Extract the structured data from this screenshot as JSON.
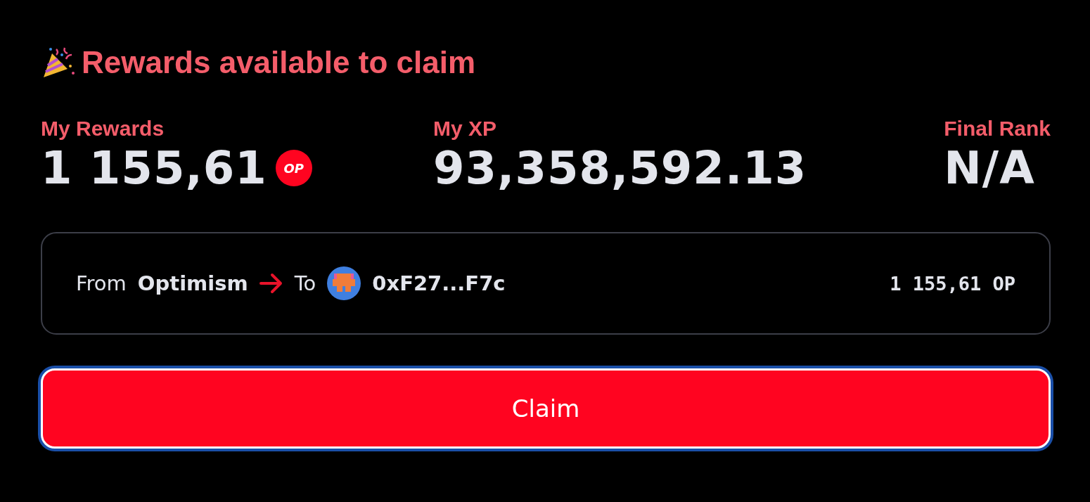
{
  "title": "Rewards available to claim",
  "stats": [
    {
      "label": "My Rewards",
      "value": "1 155,61",
      "token": "OP"
    },
    {
      "label": "My XP",
      "value": "93,358,592.13"
    },
    {
      "label": "Final Rank",
      "value": "N/A"
    }
  ],
  "transfer": {
    "from_label": "From",
    "from": "Optimism",
    "to_label": "To",
    "to": "0xF27...F7c",
    "amount": "1 155,61 OP"
  },
  "claim_button": {
    "label": "Claim",
    "focused": true
  }
}
